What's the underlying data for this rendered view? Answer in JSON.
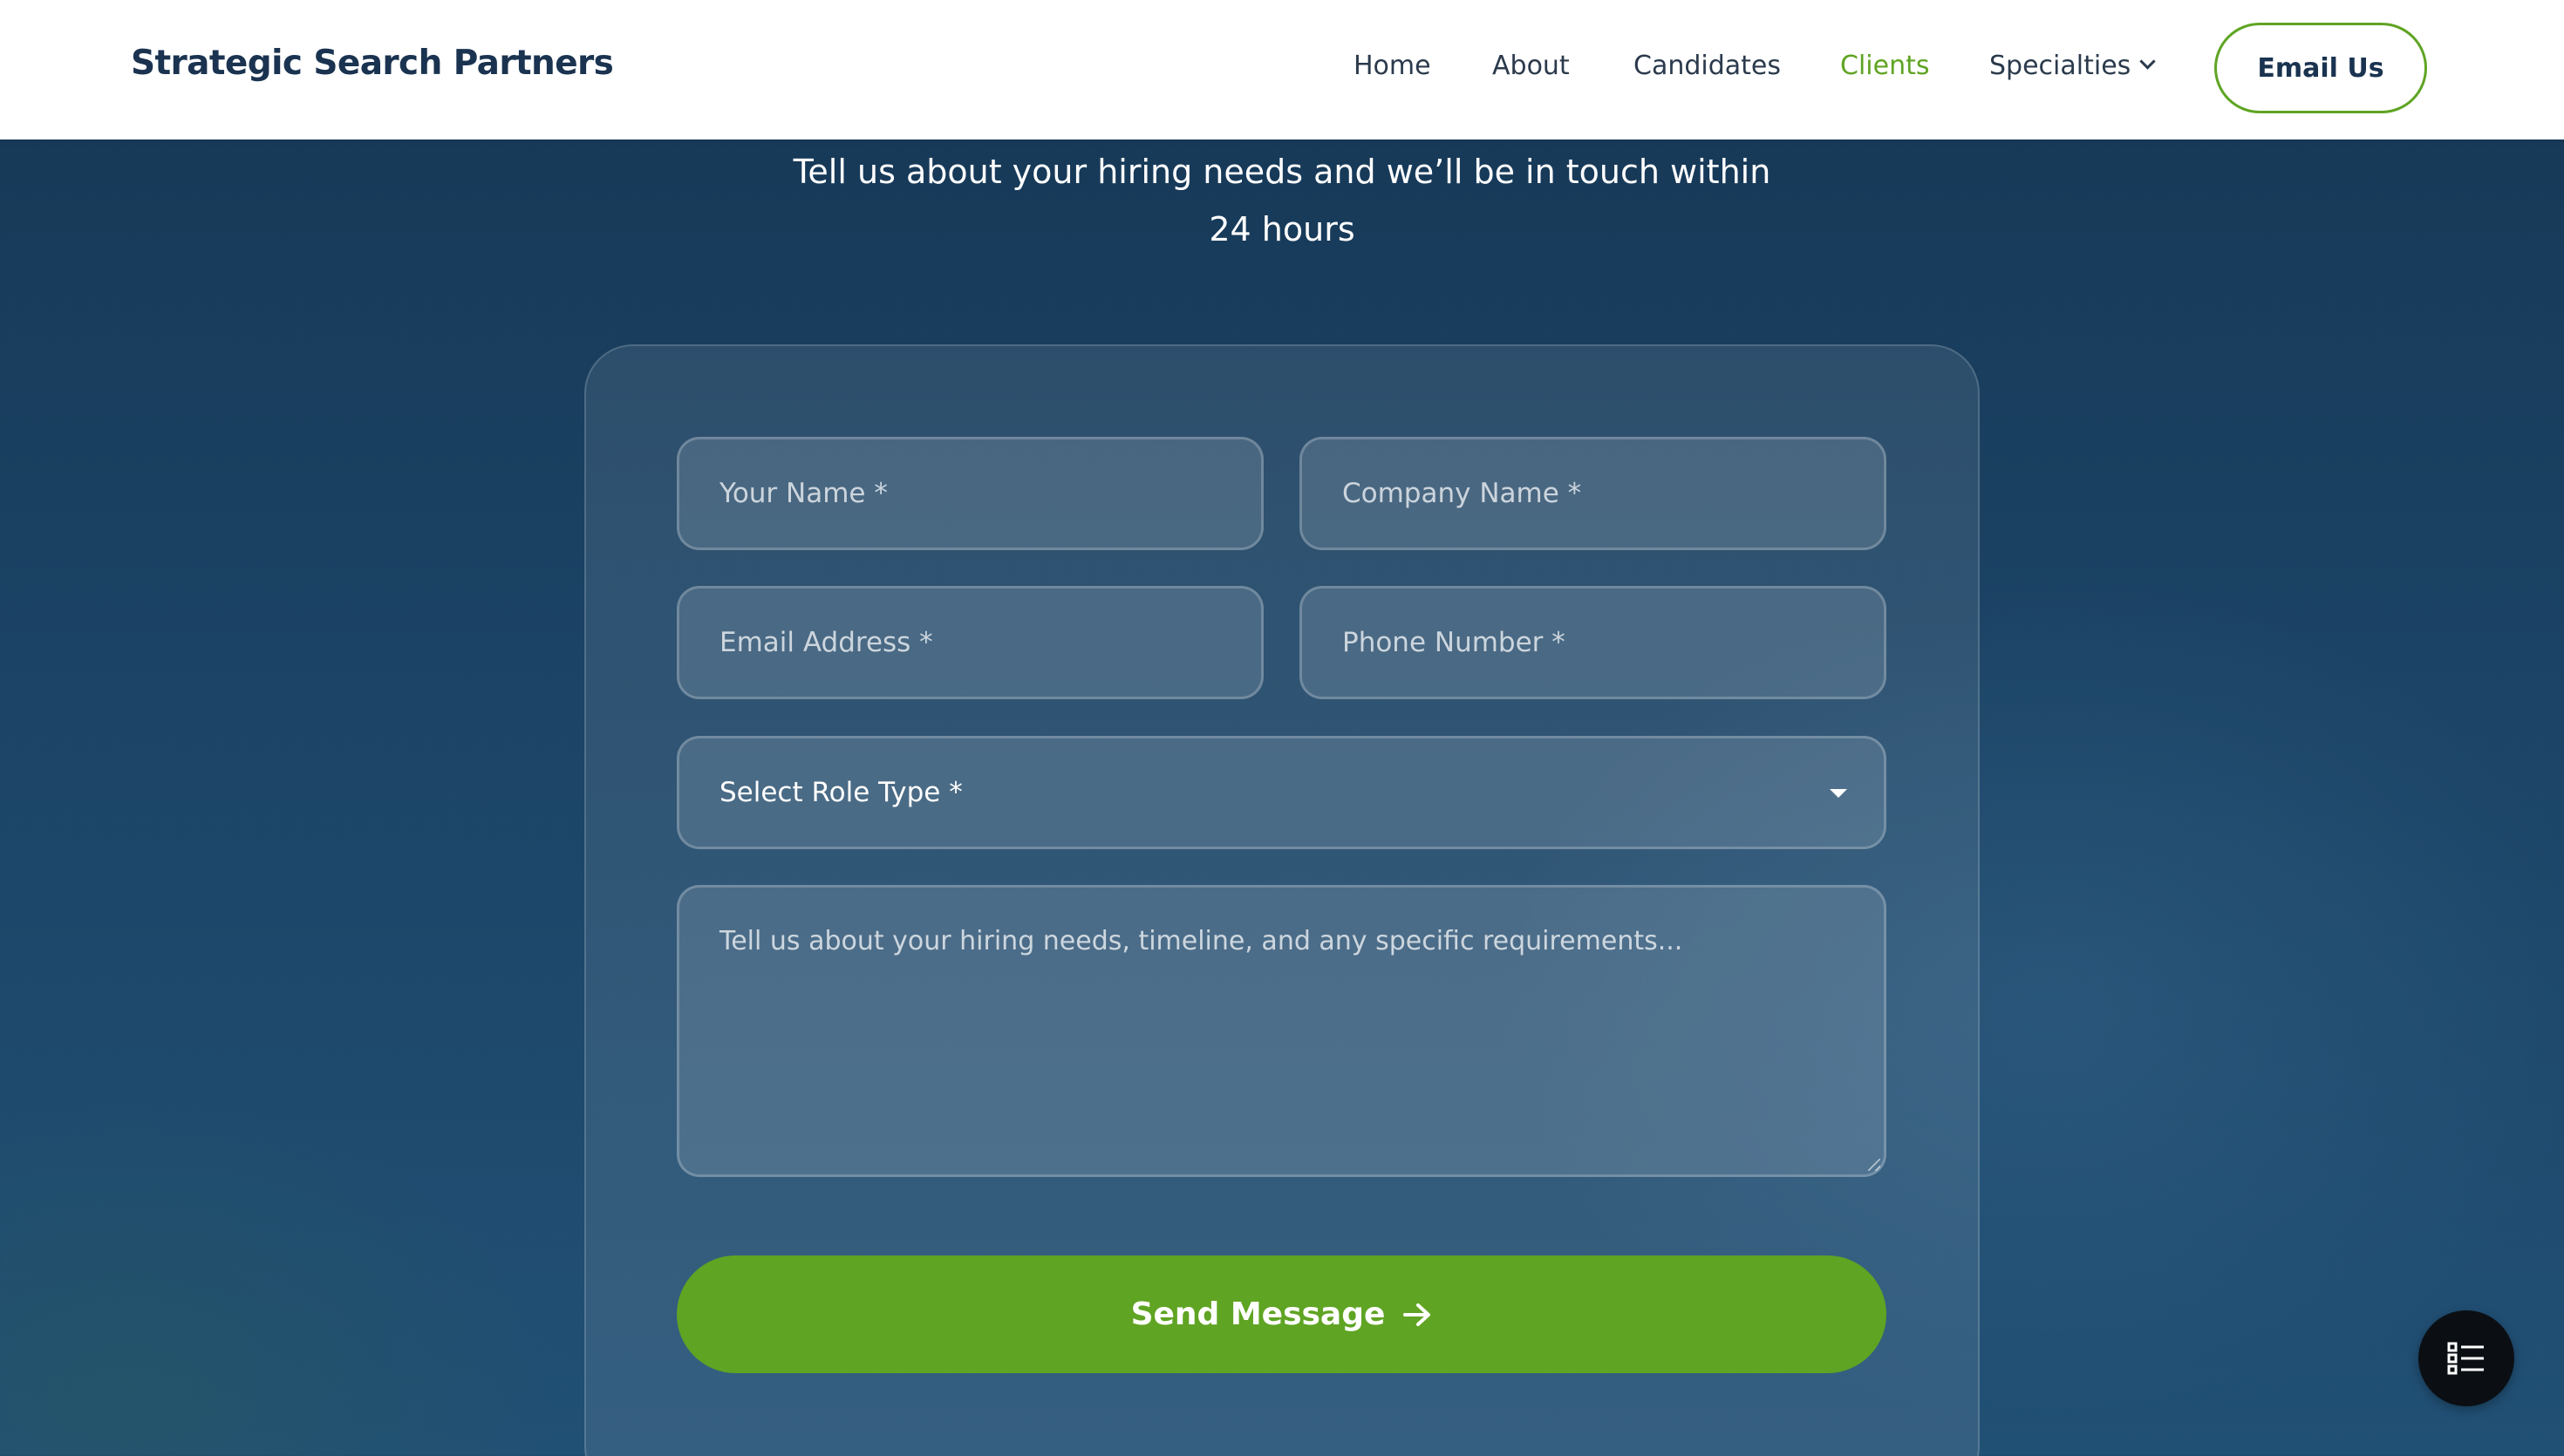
{
  "header": {
    "logo": "Strategic Search Partners",
    "nav": {
      "home": "Home",
      "about": "About",
      "candidates": "Candidates",
      "clients": "Clients",
      "specialties": "Specialties"
    },
    "active_nav": "Clients",
    "cta_label": "Email Us"
  },
  "hero": {
    "subtitle_line1": "Tell us about your hiring needs and we’ll be in touch within",
    "subtitle_line2": "24 hours"
  },
  "form": {
    "name_placeholder": "Your Name *",
    "company_placeholder": "Company Name *",
    "email_placeholder": "Email Address *",
    "phone_placeholder": "Phone Number *",
    "role_select_value": "Select Role Type *",
    "message_placeholder": "Tell us about your hiring needs, timeline, and any specific requirements...",
    "submit_label": "Send Message"
  },
  "colors": {
    "accent_green": "#5fa423",
    "navy": "#1a3350",
    "background_top": "#163755",
    "background_bottom": "#215075"
  },
  "icons": {
    "specialties_dropdown": "chevron-down-icon",
    "select_caret": "caret-down-icon",
    "submit_arrow": "arrow-right-icon",
    "fab": "list-icon"
  }
}
